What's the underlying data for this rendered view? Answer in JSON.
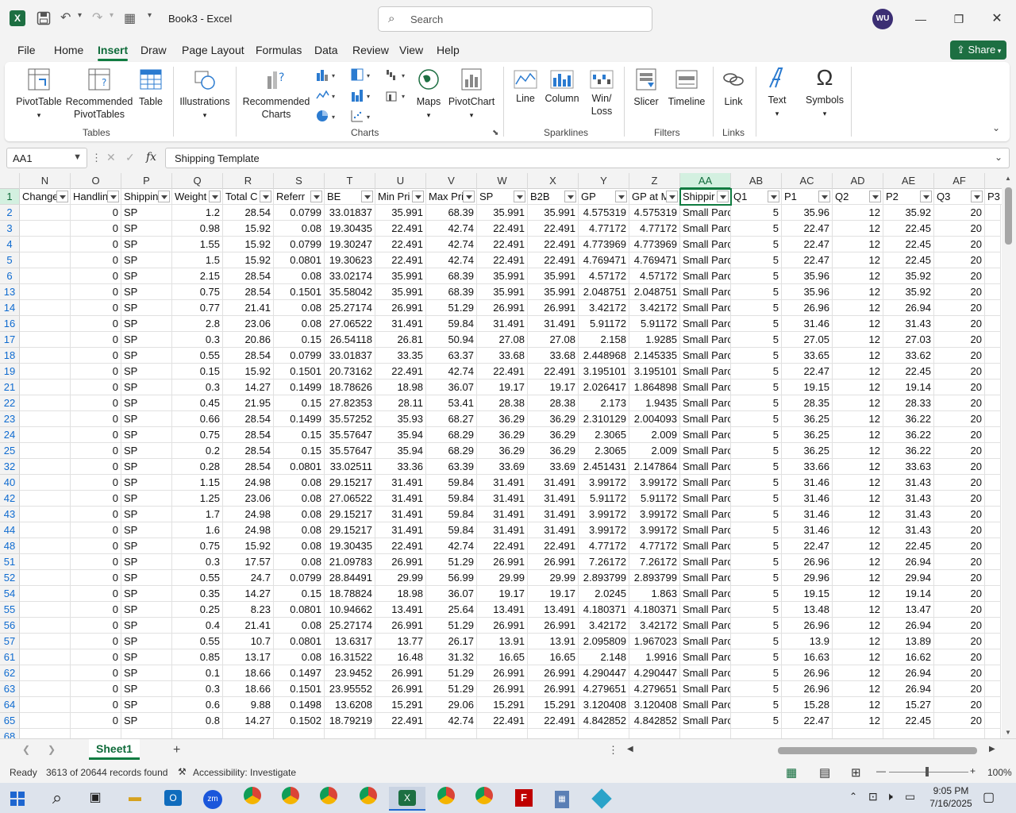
{
  "window": {
    "app_name": "Excel",
    "doc_title": "Book3  -  Excel",
    "search_placeholder": "Search",
    "user_initials": "WU",
    "share_label": "Share"
  },
  "ribbon_tabs": [
    "File",
    "Home",
    "Insert",
    "Draw",
    "Page Layout",
    "Formulas",
    "Data",
    "Review",
    "View",
    "Help"
  ],
  "active_tab": "Insert",
  "ribbon": {
    "pivottable": "PivotTable",
    "recommended_pivot": "Recommended PivotTables",
    "table": "Table",
    "illustrations": "Illustrations",
    "recommended_charts": "Recommended Charts",
    "maps": "Maps",
    "pivotchart": "PivotChart",
    "line": "Line",
    "column": "Column",
    "winloss": "Win/ Loss",
    "slicer": "Slicer",
    "timeline": "Timeline",
    "link": "Link",
    "text": "Text",
    "symbols": "Symbols",
    "groups": {
      "tables": "Tables",
      "charts": "Charts",
      "sparklines": "Sparklines",
      "filters": "Filters",
      "links": "Links"
    }
  },
  "formula_bar": {
    "name_box": "AA1",
    "fx": "fx",
    "content": "Shipping Template"
  },
  "columns": [
    "N",
    "O",
    "P",
    "Q",
    "R",
    "S",
    "T",
    "U",
    "V",
    "W",
    "X",
    "Y",
    "Z",
    "AA",
    "AB",
    "AC",
    "AD",
    "AE",
    "AF"
  ],
  "header_row": [
    "Change",
    "Handlin",
    "Shippin",
    "Weight",
    "Total C",
    "Referr",
    "BE",
    "Min Pri",
    "Max Pri",
    "SP",
    "B2B",
    "GP",
    "GP at M",
    "Shippir",
    "Q1",
    "P1",
    "Q2",
    "P2",
    "Q3",
    "P3"
  ],
  "row_numbers": [
    "1",
    "2",
    "3",
    "4",
    "5",
    "6",
    "13",
    "14",
    "16",
    "17",
    "18",
    "19",
    "21",
    "22",
    "23",
    "24",
    "25",
    "32",
    "40",
    "42",
    "43",
    "44",
    "48",
    "51",
    "52",
    "54",
    "55",
    "56",
    "57",
    "61",
    "62",
    "63",
    "64",
    "65",
    "68"
  ],
  "rows": [
    [
      "",
      "0",
      "SP",
      "1.2",
      "28.54",
      "0.0799",
      "33.01837",
      "35.991",
      "68.39",
      "35.991",
      "35.991",
      "4.575319",
      "4.575319",
      "Small Parc",
      "5",
      "35.96",
      "12",
      "35.92",
      "20"
    ],
    [
      "",
      "0",
      "SP",
      "0.98",
      "15.92",
      "0.08",
      "19.30435",
      "22.491",
      "42.74",
      "22.491",
      "22.491",
      "4.77172",
      "4.77172",
      "Small Parc",
      "5",
      "22.47",
      "12",
      "22.45",
      "20"
    ],
    [
      "",
      "0",
      "SP",
      "1.55",
      "15.92",
      "0.0799",
      "19.30247",
      "22.491",
      "42.74",
      "22.491",
      "22.491",
      "4.773969",
      "4.773969",
      "Small Parc",
      "5",
      "22.47",
      "12",
      "22.45",
      "20"
    ],
    [
      "",
      "0",
      "SP",
      "1.5",
      "15.92",
      "0.0801",
      "19.30623",
      "22.491",
      "42.74",
      "22.491",
      "22.491",
      "4.769471",
      "4.769471",
      "Small Parc",
      "5",
      "22.47",
      "12",
      "22.45",
      "20"
    ],
    [
      "",
      "0",
      "SP",
      "2.15",
      "28.54",
      "0.08",
      "33.02174",
      "35.991",
      "68.39",
      "35.991",
      "35.991",
      "4.57172",
      "4.57172",
      "Small Parc",
      "5",
      "35.96",
      "12",
      "35.92",
      "20"
    ],
    [
      "",
      "0",
      "SP",
      "0.75",
      "28.54",
      "0.1501",
      "35.58042",
      "35.991",
      "68.39",
      "35.991",
      "35.991",
      "2.048751",
      "2.048751",
      "Small Parc",
      "5",
      "35.96",
      "12",
      "35.92",
      "20"
    ],
    [
      "",
      "0",
      "SP",
      "0.77",
      "21.41",
      "0.08",
      "25.27174",
      "26.991",
      "51.29",
      "26.991",
      "26.991",
      "3.42172",
      "3.42172",
      "Small Parc",
      "5",
      "26.96",
      "12",
      "26.94",
      "20"
    ],
    [
      "",
      "0",
      "SP",
      "2.8",
      "23.06",
      "0.08",
      "27.06522",
      "31.491",
      "59.84",
      "31.491",
      "31.491",
      "5.91172",
      "5.91172",
      "Small Parc",
      "5",
      "31.46",
      "12",
      "31.43",
      "20"
    ],
    [
      "",
      "0",
      "SP",
      "0.3",
      "20.86",
      "0.15",
      "26.54118",
      "26.81",
      "50.94",
      "27.08",
      "27.08",
      "2.158",
      "1.9285",
      "Small Parc",
      "5",
      "27.05",
      "12",
      "27.03",
      "20"
    ],
    [
      "",
      "0",
      "SP",
      "0.55",
      "28.54",
      "0.0799",
      "33.01837",
      "33.35",
      "63.37",
      "33.68",
      "33.68",
      "2.448968",
      "2.145335",
      "Small Parc",
      "5",
      "33.65",
      "12",
      "33.62",
      "20"
    ],
    [
      "",
      "0",
      "SP",
      "0.15",
      "15.92",
      "0.1501",
      "20.73162",
      "22.491",
      "42.74",
      "22.491",
      "22.491",
      "3.195101",
      "3.195101",
      "Small Parc",
      "5",
      "22.47",
      "12",
      "22.45",
      "20"
    ],
    [
      "",
      "0",
      "SP",
      "0.3",
      "14.27",
      "0.1499",
      "18.78626",
      "18.98",
      "36.07",
      "19.17",
      "19.17",
      "2.026417",
      "1.864898",
      "Small Parc",
      "5",
      "19.15",
      "12",
      "19.14",
      "20"
    ],
    [
      "",
      "0",
      "SP",
      "0.45",
      "21.95",
      "0.15",
      "27.82353",
      "28.11",
      "53.41",
      "28.38",
      "28.38",
      "2.173",
      "1.9435",
      "Small Parc",
      "5",
      "28.35",
      "12",
      "28.33",
      "20"
    ],
    [
      "",
      "0",
      "SP",
      "0.66",
      "28.54",
      "0.1499",
      "35.57252",
      "35.93",
      "68.27",
      "36.29",
      "36.29",
      "2.310129",
      "2.004093",
      "Small Parc",
      "5",
      "36.25",
      "12",
      "36.22",
      "20"
    ],
    [
      "",
      "0",
      "SP",
      "0.75",
      "28.54",
      "0.15",
      "35.57647",
      "35.94",
      "68.29",
      "36.29",
      "36.29",
      "2.3065",
      "2.009",
      "Small Parc",
      "5",
      "36.25",
      "12",
      "36.22",
      "20"
    ],
    [
      "",
      "0",
      "SP",
      "0.2",
      "28.54",
      "0.15",
      "35.57647",
      "35.94",
      "68.29",
      "36.29",
      "36.29",
      "2.3065",
      "2.009",
      "Small Parc",
      "5",
      "36.25",
      "12",
      "36.22",
      "20"
    ],
    [
      "",
      "0",
      "SP",
      "0.28",
      "28.54",
      "0.0801",
      "33.02511",
      "33.36",
      "63.39",
      "33.69",
      "33.69",
      "2.451431",
      "2.147864",
      "Small Parc",
      "5",
      "33.66",
      "12",
      "33.63",
      "20"
    ],
    [
      "",
      "0",
      "SP",
      "1.15",
      "24.98",
      "0.08",
      "29.15217",
      "31.491",
      "59.84",
      "31.491",
      "31.491",
      "3.99172",
      "3.99172",
      "Small Parc",
      "5",
      "31.46",
      "12",
      "31.43",
      "20"
    ],
    [
      "",
      "0",
      "SP",
      "1.25",
      "23.06",
      "0.08",
      "27.06522",
      "31.491",
      "59.84",
      "31.491",
      "31.491",
      "5.91172",
      "5.91172",
      "Small Parc",
      "5",
      "31.46",
      "12",
      "31.43",
      "20"
    ],
    [
      "",
      "0",
      "SP",
      "1.7",
      "24.98",
      "0.08",
      "29.15217",
      "31.491",
      "59.84",
      "31.491",
      "31.491",
      "3.99172",
      "3.99172",
      "Small Parc",
      "5",
      "31.46",
      "12",
      "31.43",
      "20"
    ],
    [
      "",
      "0",
      "SP",
      "1.6",
      "24.98",
      "0.08",
      "29.15217",
      "31.491",
      "59.84",
      "31.491",
      "31.491",
      "3.99172",
      "3.99172",
      "Small Parc",
      "5",
      "31.46",
      "12",
      "31.43",
      "20"
    ],
    [
      "",
      "0",
      "SP",
      "0.75",
      "15.92",
      "0.08",
      "19.30435",
      "22.491",
      "42.74",
      "22.491",
      "22.491",
      "4.77172",
      "4.77172",
      "Small Parc",
      "5",
      "22.47",
      "12",
      "22.45",
      "20"
    ],
    [
      "",
      "0",
      "SP",
      "0.3",
      "17.57",
      "0.08",
      "21.09783",
      "26.991",
      "51.29",
      "26.991",
      "26.991",
      "7.26172",
      "7.26172",
      "Small Parc",
      "5",
      "26.96",
      "12",
      "26.94",
      "20"
    ],
    [
      "",
      "0",
      "SP",
      "0.55",
      "24.7",
      "0.0799",
      "28.84491",
      "29.99",
      "56.99",
      "29.99",
      "29.99",
      "2.893799",
      "2.893799",
      "Small Parc",
      "5",
      "29.96",
      "12",
      "29.94",
      "20"
    ],
    [
      "",
      "0",
      "SP",
      "0.35",
      "14.27",
      "0.15",
      "18.78824",
      "18.98",
      "36.07",
      "19.17",
      "19.17",
      "2.0245",
      "1.863",
      "Small Parc",
      "5",
      "19.15",
      "12",
      "19.14",
      "20"
    ],
    [
      "",
      "0",
      "SP",
      "0.25",
      "8.23",
      "0.0801",
      "10.94662",
      "13.491",
      "25.64",
      "13.491",
      "13.491",
      "4.180371",
      "4.180371",
      "Small Parc",
      "5",
      "13.48",
      "12",
      "13.47",
      "20"
    ],
    [
      "",
      "0",
      "SP",
      "0.4",
      "21.41",
      "0.08",
      "25.27174",
      "26.991",
      "51.29",
      "26.991",
      "26.991",
      "3.42172",
      "3.42172",
      "Small Parc",
      "5",
      "26.96",
      "12",
      "26.94",
      "20"
    ],
    [
      "",
      "0",
      "SP",
      "0.55",
      "10.7",
      "0.0801",
      "13.6317",
      "13.77",
      "26.17",
      "13.91",
      "13.91",
      "2.095809",
      "1.967023",
      "Small Parc",
      "5",
      "13.9",
      "12",
      "13.89",
      "20"
    ],
    [
      "",
      "0",
      "SP",
      "0.85",
      "13.17",
      "0.08",
      "16.31522",
      "16.48",
      "31.32",
      "16.65",
      "16.65",
      "2.148",
      "1.9916",
      "Small Parc",
      "5",
      "16.63",
      "12",
      "16.62",
      "20"
    ],
    [
      "",
      "0",
      "SP",
      "0.1",
      "18.66",
      "0.1497",
      "23.9452",
      "26.991",
      "51.29",
      "26.991",
      "26.991",
      "4.290447",
      "4.290447",
      "Small Parc",
      "5",
      "26.96",
      "12",
      "26.94",
      "20"
    ],
    [
      "",
      "0",
      "SP",
      "0.3",
      "18.66",
      "0.1501",
      "23.95552",
      "26.991",
      "51.29",
      "26.991",
      "26.991",
      "4.279651",
      "4.279651",
      "Small Parc",
      "5",
      "26.96",
      "12",
      "26.94",
      "20"
    ],
    [
      "",
      "0",
      "SP",
      "0.6",
      "9.88",
      "0.1498",
      "13.6208",
      "15.291",
      "29.06",
      "15.291",
      "15.291",
      "3.120408",
      "3.120408",
      "Small Parc",
      "5",
      "15.28",
      "12",
      "15.27",
      "20"
    ],
    [
      "",
      "0",
      "SP",
      "0.8",
      "14.27",
      "0.1502",
      "18.79219",
      "22.491",
      "42.74",
      "22.491",
      "22.491",
      "4.842852",
      "4.842852",
      "Small Parc",
      "5",
      "22.47",
      "12",
      "22.45",
      "20"
    ]
  ],
  "sheet": {
    "tab_name": "Sheet1",
    "add": "+"
  },
  "status": {
    "ready": "Ready",
    "records": "3613 of 20644 records found",
    "accessibility": "Accessibility: Investigate",
    "zoom": "100%"
  },
  "taskbar": {
    "time": "9:05 PM",
    "date": "7/16/2025"
  }
}
